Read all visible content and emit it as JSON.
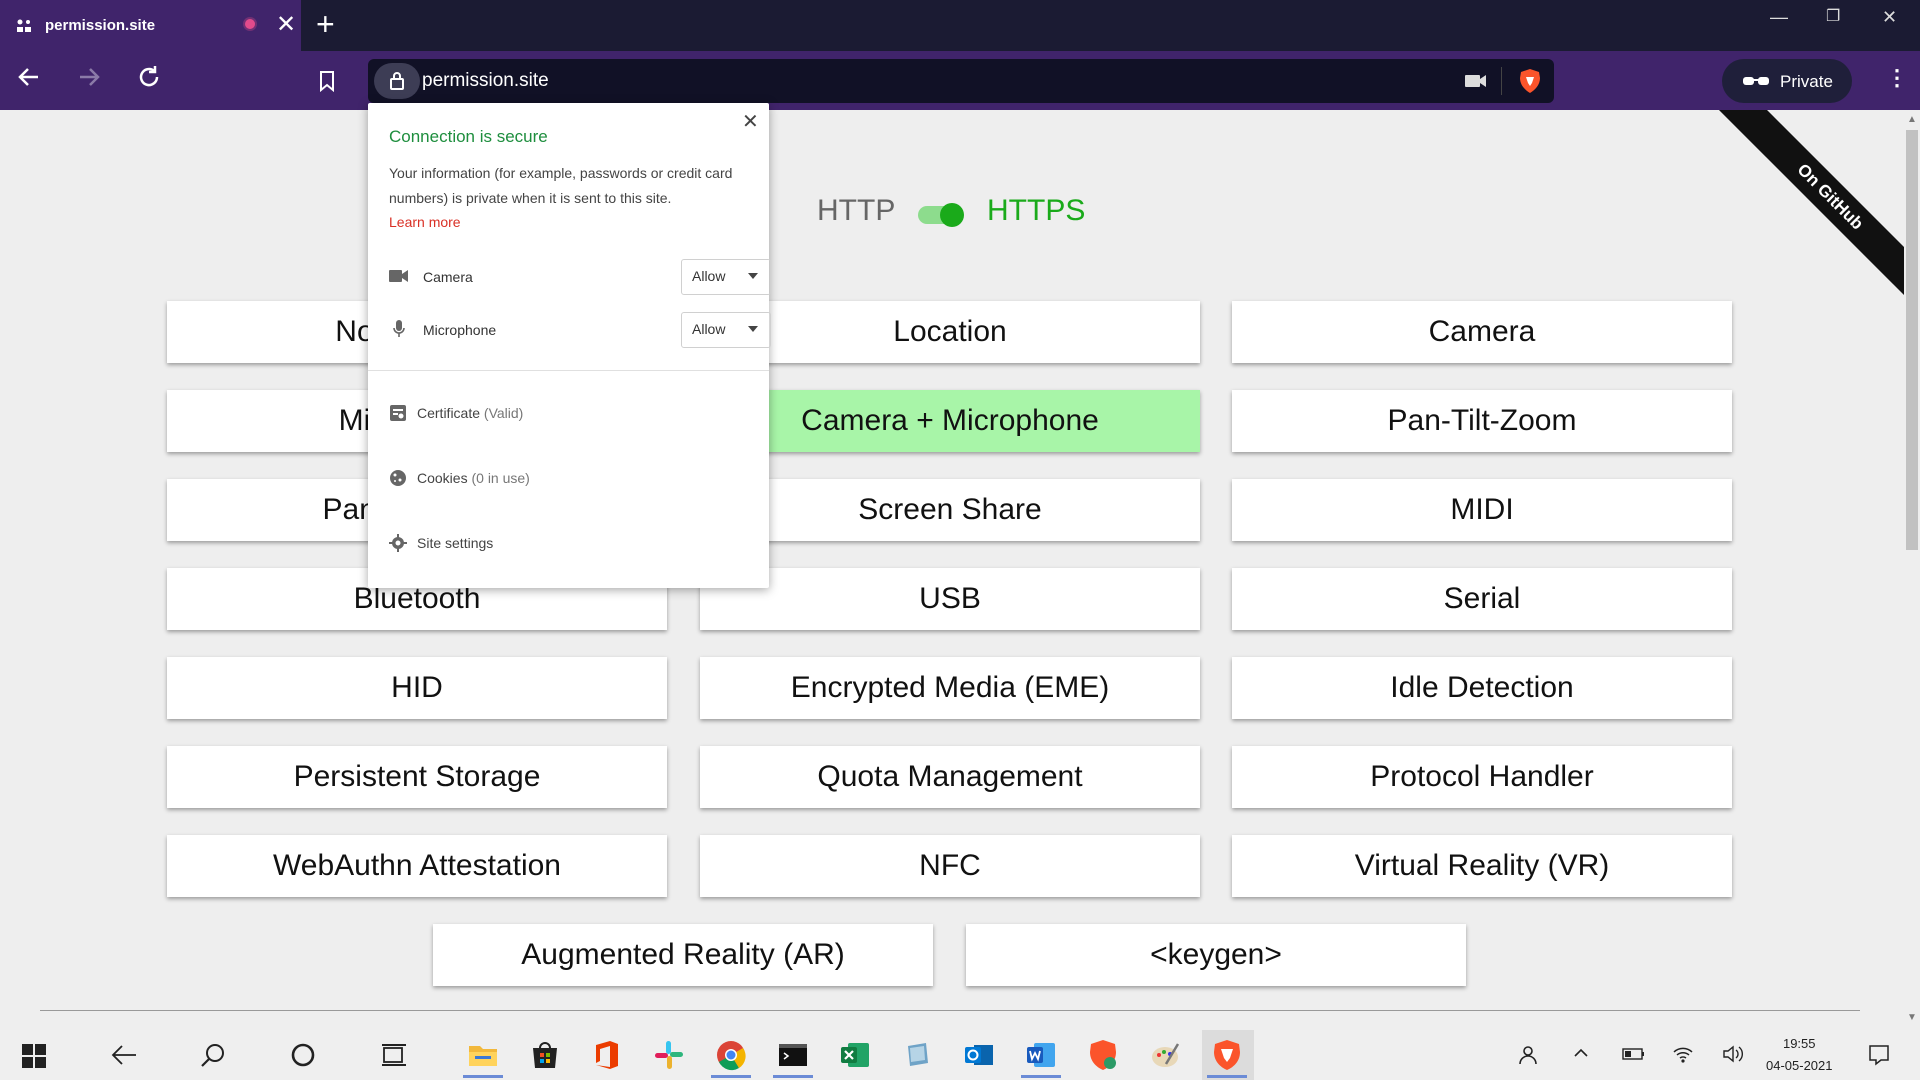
{
  "browser": {
    "tab_title": "permission.site",
    "url": "permission.site",
    "private_label": "Private"
  },
  "page": {
    "http_label": "HTTP",
    "https_label": "HTTPS",
    "ribbon_text": "On GitHub",
    "buttons": [
      "Notifications",
      "Location",
      "Camera",
      "Microphone",
      "Camera + Microphone",
      "Pan-Tilt-Zoom",
      "Pan-Tilt-Zoom",
      "Screen Share",
      "MIDI",
      "Bluetooth",
      "USB",
      "Serial",
      "HID",
      "Encrypted Media (EME)",
      "Idle Detection",
      "Persistent Storage",
      "Quota Management",
      "Protocol Handler",
      "WebAuthn Attestation",
      "NFC",
      "Virtual Reality (VR)",
      "Augmented Reality (AR)",
      "<keygen>"
    ],
    "active_button": "Camera + Microphone"
  },
  "site_info_popup": {
    "title": "Connection is secure",
    "description": "Your information (for example, passwords or credit card numbers) is private when it is sent to this site.",
    "learn_more": "Learn more",
    "permissions": [
      {
        "label": "Camera",
        "value": "Allow",
        "icon": "camera-icon"
      },
      {
        "label": "Microphone",
        "value": "Allow",
        "icon": "microphone-icon"
      }
    ],
    "links": [
      {
        "label": "Certificate",
        "suffix": "(Valid)",
        "icon": "certificate-icon"
      },
      {
        "label": "Cookies",
        "suffix": "(0 in use)",
        "icon": "cookies-icon"
      },
      {
        "label": "Site settings",
        "suffix": "",
        "icon": "gear-icon"
      }
    ]
  },
  "taskbar": {
    "time": "19:55",
    "date": "04-05-2021"
  },
  "colors": {
    "tab_purple": "#40246b",
    "title_bar": "#1b1b33",
    "https_green": "#1aaa1a",
    "active_button": "#a8f5a8",
    "secure_green": "#1e8e3e"
  }
}
